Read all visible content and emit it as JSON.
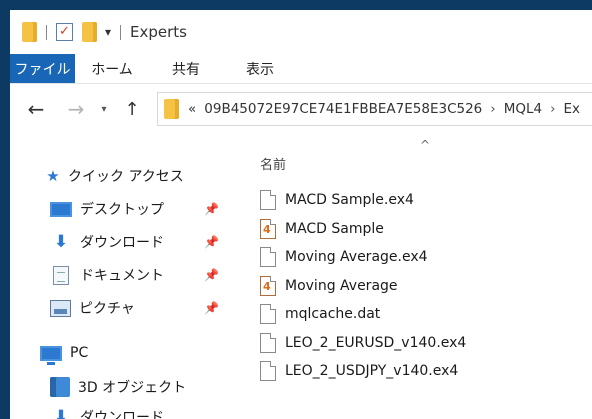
{
  "window": {
    "title": "Experts"
  },
  "quick_access_toolbar": {
    "icons": [
      "folder-icon",
      "properties-check-icon",
      "new-folder-icon",
      "customize-dropdown-icon"
    ],
    "dropdown_glyph": "▾"
  },
  "ribbon": {
    "tabs": [
      "ファイル",
      "ホーム",
      "共有",
      "表示"
    ]
  },
  "address_bar": {
    "prefix": "«",
    "segments": [
      "09B45072E97CE74E1FBBEA7E58E3C526",
      "MQL4",
      "Ex"
    ],
    "separator": "›"
  },
  "nav_pane": {
    "quick_access": "クイック アクセス",
    "items": [
      {
        "label": "デスクトップ",
        "icon": "desktop-icon",
        "pinned": true
      },
      {
        "label": "ダウンロード",
        "icon": "download-icon",
        "pinned": true
      },
      {
        "label": "ドキュメント",
        "icon": "documents-icon",
        "pinned": true
      },
      {
        "label": "ピクチャ",
        "icon": "pictures-icon",
        "pinned": true
      }
    ],
    "pc": "PC",
    "pc_items": [
      {
        "label": "3D オブジェクト",
        "icon": "3d-objects-icon"
      },
      {
        "label": "ダウンロード",
        "icon": "download-icon"
      }
    ],
    "pin_glyph": "📌"
  },
  "file_list": {
    "column_header": "名前",
    "sort_glyph": "^",
    "files": [
      {
        "name": "MACD Sample.ex4",
        "icon": "file-icon"
      },
      {
        "name": "MACD Sample",
        "icon": "mq4-source-icon"
      },
      {
        "name": "Moving Average.ex4",
        "icon": "file-icon"
      },
      {
        "name": "Moving Average",
        "icon": "mq4-source-icon"
      },
      {
        "name": "mqlcache.dat",
        "icon": "file-icon"
      },
      {
        "name": "LEO_2_EURUSD_v140.ex4",
        "icon": "file-icon"
      },
      {
        "name": "LEO_2_USDJPY_v140.ex4",
        "icon": "file-icon"
      }
    ]
  },
  "colors": {
    "accent": "#1a66b6",
    "folder": "#f6c244",
    "desktop_background": "#0c3a63"
  }
}
